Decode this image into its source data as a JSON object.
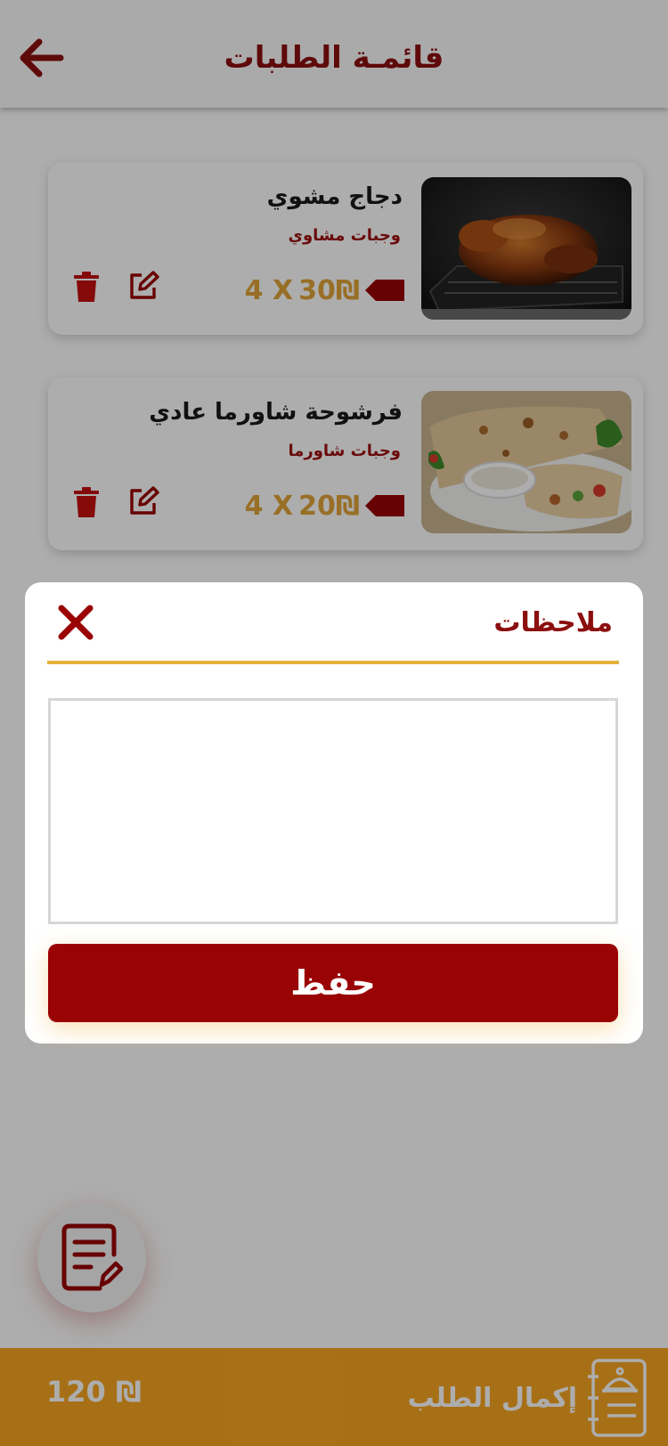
{
  "header": {
    "title": "قائمـة الطلبات",
    "back_icon": "arrow-left-icon"
  },
  "items": [
    {
      "name": "دجاج مشوي",
      "category": "وجبات مشاوي",
      "price": "30₪",
      "quantity": "4 X",
      "image": "grilled-chicken"
    },
    {
      "name": "فرشوحة شاورما عادي",
      "category": "وجبات شاورما",
      "price": "20₪",
      "quantity": "4 X",
      "image": "shawarma-wrap"
    }
  ],
  "modal": {
    "title": "ملاحظات",
    "notes_value": "",
    "save_label": "حفظ",
    "close_icon": "close-icon"
  },
  "fab": {
    "icon": "notes-edit-icon"
  },
  "footer": {
    "total": "120 ₪",
    "checkout_label": "إكمال الطلب",
    "checkout_icon": "clipboard-bell-icon"
  },
  "colors": {
    "primary": "#9a0303",
    "accent": "#f7a623",
    "price": "#e1a43a",
    "divider": "#e3b23c"
  }
}
